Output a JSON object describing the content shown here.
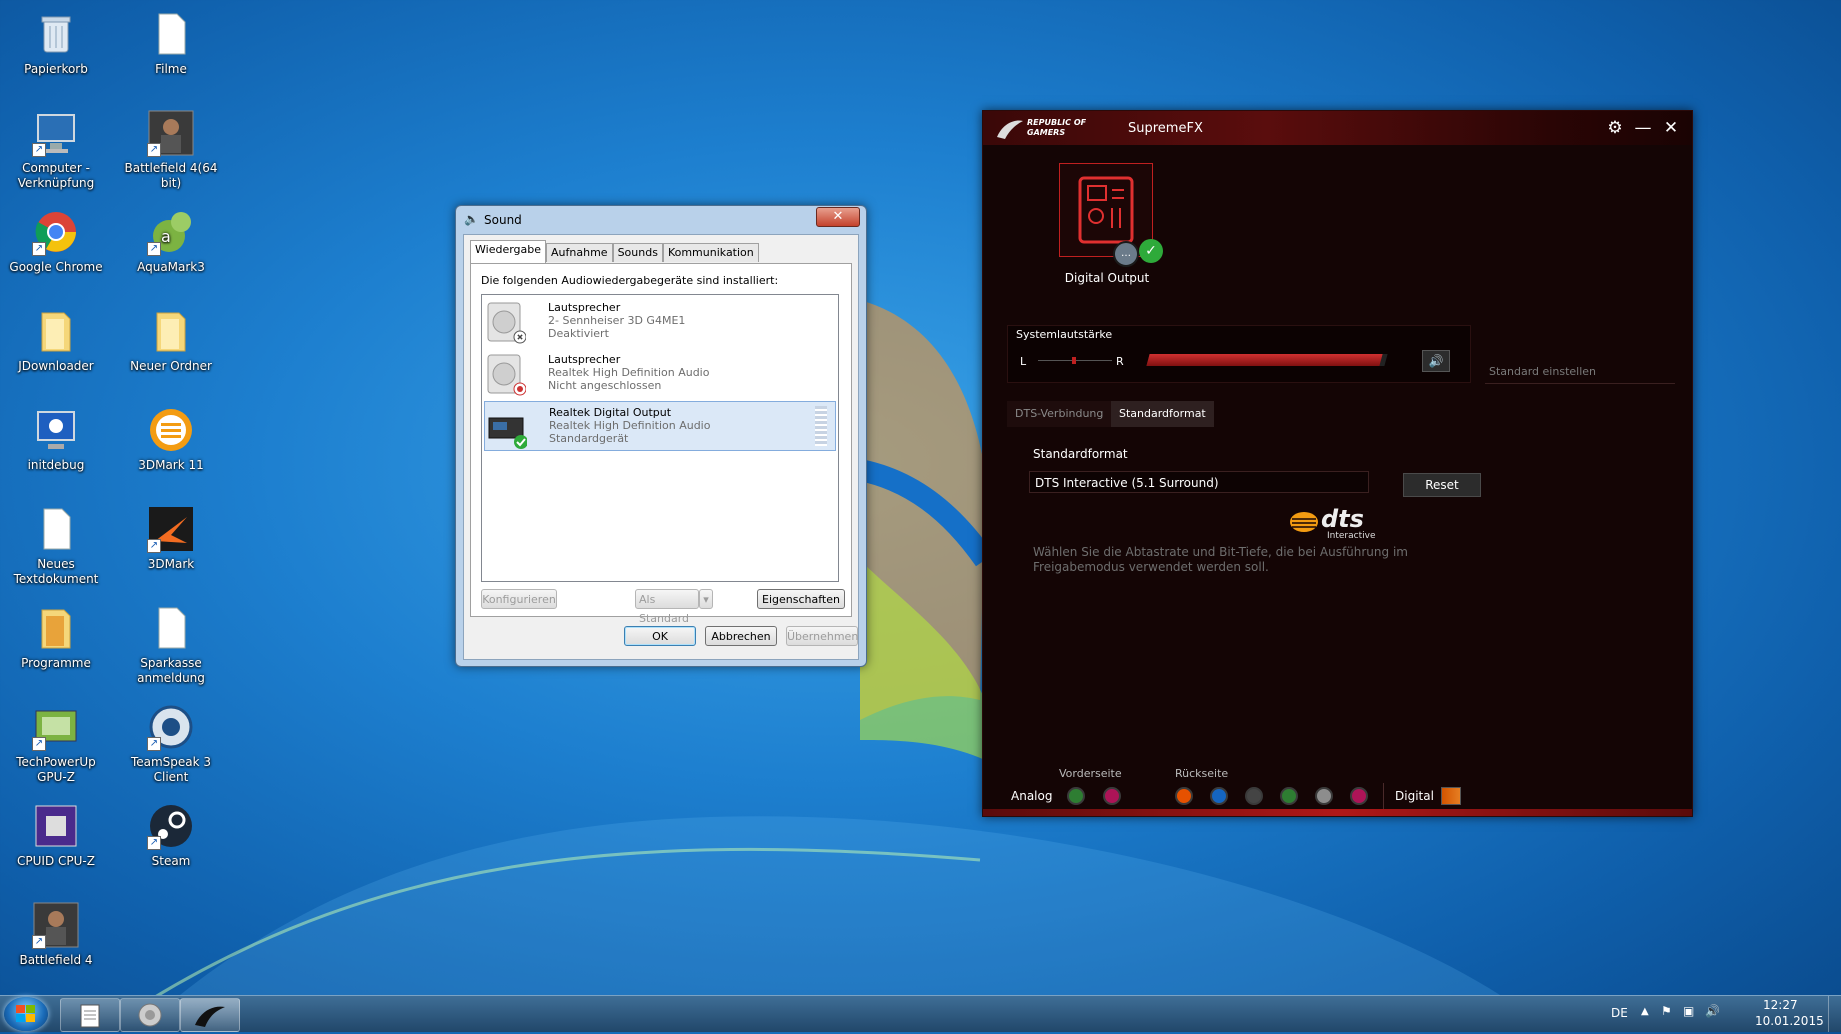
{
  "desktop": {
    "icons": [
      {
        "label": "Papierkorb",
        "icon": "recycle-bin-icon"
      },
      {
        "label": "Filme",
        "icon": "document-icon"
      },
      {
        "label": "Computer - Verknüpfung",
        "icon": "computer-icon"
      },
      {
        "label": "Battlefield 4(64 bit)",
        "icon": "battlefield-icon"
      },
      {
        "label": "Google Chrome",
        "icon": "chrome-icon"
      },
      {
        "label": "AquaMark3",
        "icon": "aquamark-icon"
      },
      {
        "label": "JDownloader",
        "icon": "folder-icon"
      },
      {
        "label": "Neuer Ordner",
        "icon": "folder-icon"
      },
      {
        "label": "initdebug",
        "icon": "monitor-icon"
      },
      {
        "label": "3DMark 11",
        "icon": "3dmark11-icon"
      },
      {
        "label": "Neues Textdokument",
        "icon": "document-icon"
      },
      {
        "label": "3DMark",
        "icon": "3dmark-icon"
      },
      {
        "label": "Programme",
        "icon": "folder-icon"
      },
      {
        "label": "Sparkasse anmeldung",
        "icon": "document-icon"
      },
      {
        "label": "TechPowerUp GPU-Z",
        "icon": "gpuz-icon"
      },
      {
        "label": "TeamSpeak 3 Client",
        "icon": "teamspeak-icon"
      },
      {
        "label": "CPUID CPU-Z",
        "icon": "cpuz-icon"
      },
      {
        "label": "Steam",
        "icon": "steam-icon"
      },
      {
        "label": "Battlefield 4",
        "icon": "battlefield-icon"
      }
    ]
  },
  "sound_dialog": {
    "title": "Sound",
    "close": "✕",
    "tabs": [
      "Wiedergabe",
      "Aufnahme",
      "Sounds",
      "Kommunikation"
    ],
    "info": "Die folgenden Audiowiedergabegeräte sind installiert:",
    "devices": [
      {
        "name": "Lautsprecher",
        "driver": "2- Sennheiser 3D G4ME1",
        "status": "Deaktiviert"
      },
      {
        "name": "Lautsprecher",
        "driver": "Realtek High Definition Audio",
        "status": "Nicht angeschlossen"
      },
      {
        "name": "Realtek Digital Output",
        "driver": "Realtek High Definition Audio",
        "status": "Standardgerät"
      }
    ],
    "btn_configure": "Konfigurieren",
    "btn_default": "Als Standard",
    "btn_properties": "Eigenschaften",
    "btn_ok": "OK",
    "btn_cancel": "Abbrechen",
    "btn_apply": "Übernehmen"
  },
  "rog": {
    "logo_line1": "REPUBLIC OF",
    "logo_line2": "GAMERS",
    "title": "SupremeFX",
    "device_label": "Digital Output",
    "volume_title": "Systemlautstärke",
    "left": "L",
    "right": "R",
    "volume_level": 0.98,
    "standard_set": "Standard einstellen",
    "tab_dts": "DTS-Verbindung",
    "tab_format": "Standardformat",
    "format_label": "Standardformat",
    "format_value": "DTS Interactive (5.1 Surround)",
    "reset": "Reset",
    "dts_brand": "dts",
    "dts_sub": "Interactive",
    "help_text": "Wählen Sie die Abtastrate und Bit-Tiefe, die bei Ausführung im Freigabemodus verwendet werden soll.",
    "front_label": "Vorderseite",
    "back_label": "Rückseite",
    "analog_label": "Analog",
    "digital_label": "Digital",
    "front_jacks": [
      "#2e7d32",
      "#ad1457"
    ],
    "back_jacks": [
      "#e65100",
      "#1565c0",
      "#444444",
      "#2e7d32",
      "#8d8d8d",
      "#ad1457"
    ]
  },
  "taskbar": {
    "lang": "DE",
    "time": "12:27",
    "date": "10.01.2015"
  }
}
